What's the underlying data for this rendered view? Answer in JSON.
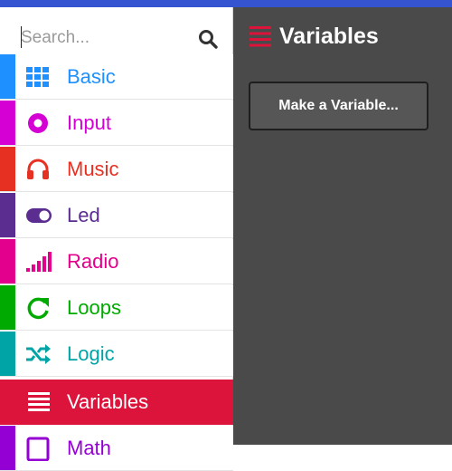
{
  "search": {
    "placeholder": "Search..."
  },
  "toolbox": {
    "categories": [
      {
        "label": "Basic",
        "color": "#1e90ff",
        "icon": "grid-icon"
      },
      {
        "label": "Input",
        "color": "#d400d4",
        "icon": "target-icon"
      },
      {
        "label": "Music",
        "color": "#e63022",
        "icon": "headphones-icon"
      },
      {
        "label": "Led",
        "color": "#5c2d91",
        "icon": "toggle-icon"
      },
      {
        "label": "Radio",
        "color": "#e3008c",
        "icon": "signal-icon"
      },
      {
        "label": "Loops",
        "color": "#00aa00",
        "icon": "refresh-icon"
      },
      {
        "label": "Logic",
        "color": "#00a4a6",
        "icon": "shuffle-icon"
      },
      {
        "label": "Variables",
        "color": "#dc143c",
        "icon": "list-icon",
        "selected": true
      },
      {
        "label": "Math",
        "color": "#9400d3",
        "icon": "calculator-icon"
      }
    ]
  },
  "flyout": {
    "title": "Variables",
    "icon": "list-icon",
    "title_color": "#dc143c",
    "make_variable_label": "Make a Variable..."
  }
}
